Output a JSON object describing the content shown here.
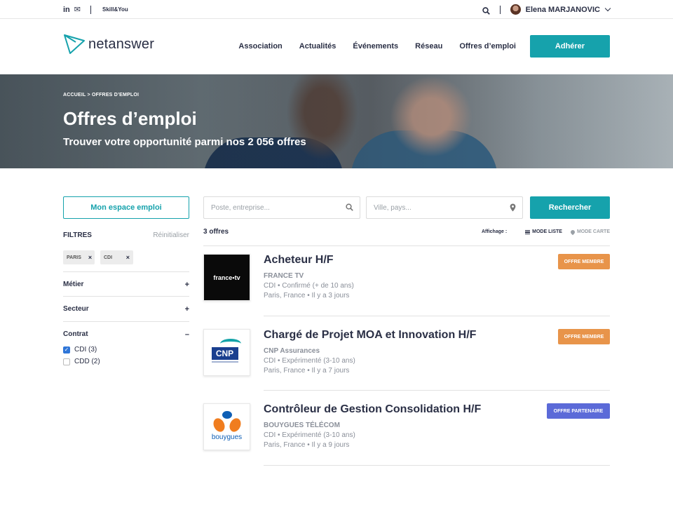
{
  "topbar": {
    "linkedin_icon": "in",
    "mail_icon": "✉",
    "brand": "Skill&You",
    "user_name": "Elena MARJANOVIC"
  },
  "header": {
    "logo_text": "netanswer",
    "nav": [
      "Association",
      "Actualités",
      "Événements",
      "Réseau",
      "Offres d’emploi"
    ],
    "cta": "Adhérer"
  },
  "hero": {
    "breadcrumb": "ACCUEIL > OFFRES D’EMPLOI",
    "title": "Offres d’emploi",
    "subtitle": "Trouver votre opportunité parmi nos 2 056 offres"
  },
  "sidebar": {
    "espace_button": "Mon espace emploi",
    "filters_title": "FILTRES",
    "reset": "Réinitialiser",
    "chips": [
      {
        "label": "PARIS",
        "remove": "×"
      },
      {
        "label": "CDI",
        "remove": "×"
      }
    ],
    "facets": {
      "metier": {
        "title": "Métier",
        "toggle": "+"
      },
      "secteur": {
        "title": "Secteur",
        "toggle": "+"
      },
      "contrat": {
        "title": "Contrat",
        "toggle": "–"
      }
    },
    "contrat_options": [
      {
        "label": "CDI (3)",
        "checked": true,
        "mark": "✓"
      },
      {
        "label": "CDD (2)",
        "checked": false,
        "mark": ""
      }
    ]
  },
  "search": {
    "keyword_placeholder": "Poste, entreprise...",
    "location_placeholder": "Ville, pays...",
    "button": "Rechercher"
  },
  "results": {
    "count": "3 offres",
    "view_label": "Affichage :",
    "list_mode": "MODE LISTE",
    "map_mode": "MODE CARTE"
  },
  "jobs": [
    {
      "title": "Acheteur H/F",
      "company": "FRANCE TV",
      "meta": "CDI • Confirmé (+ de 10 ans)",
      "location": "Paris, France • Il y a 3 jours",
      "badge": "OFFRE MEMBRE",
      "badge_color": "#e8944a",
      "logo_text": "france•tv"
    },
    {
      "title": "Chargé de Projet MOA et Innovation H/F",
      "company": "CNP Assurances",
      "meta": "CDI • Expérimenté (3-10 ans)",
      "location": "Paris, France • Il y a 7 jours",
      "badge": "OFFRE MEMBRE",
      "badge_color": "#e8944a",
      "logo_text": "CNP"
    },
    {
      "title": "Contrôleur de Gestion Consolidation H/F",
      "company": "BOUYGUES TÉLÉCOM",
      "meta": "CDI • Expérimenté (3-10 ans)",
      "location": "Paris, France • Il y a 9 jours",
      "badge": "OFFRE PARTENAIRE",
      "badge_color": "#5b6ad8",
      "logo_text": "bouygues"
    }
  ],
  "colors": {
    "accent": "#16a2ac",
    "text": "#2a2f45",
    "membre": "#e8944a",
    "partenaire": "#5b6ad8"
  }
}
